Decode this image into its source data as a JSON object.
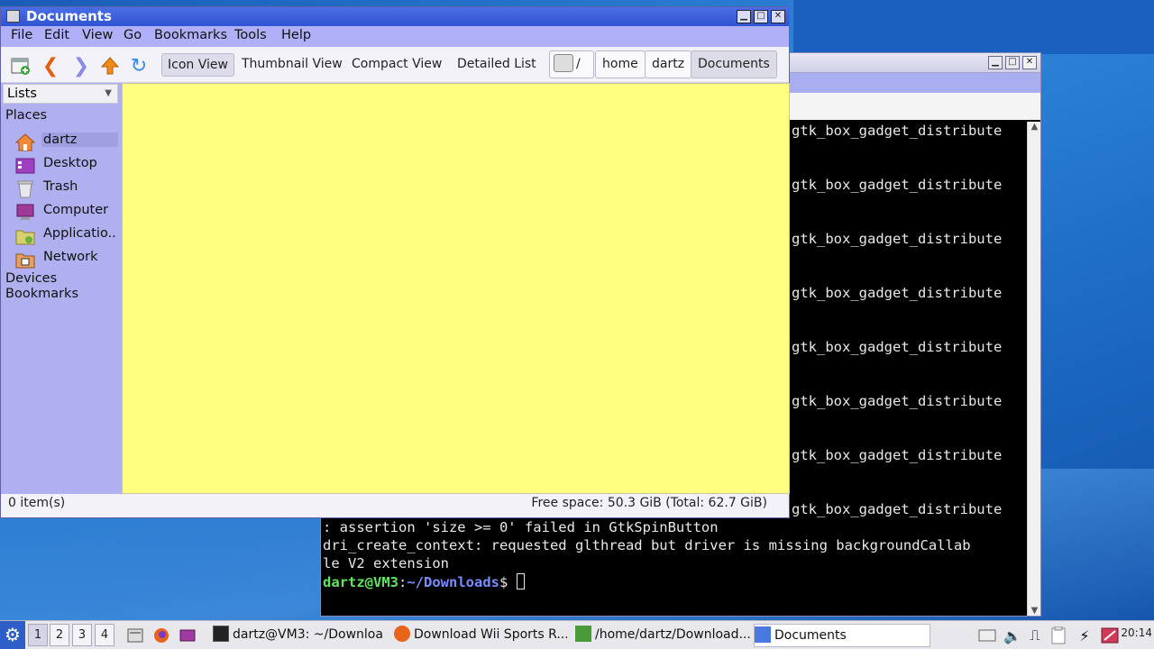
{
  "terminal": {
    "repeated_line": "gtk_box_gadget_distribute",
    "lines": [
      ": assertion 'size >= 0' failed in GtkSpinButton",
      "dri_create_context: requested glthread but driver is missing backgroundCallab",
      "le V2 extension"
    ],
    "prompt_user": "dartz@VM3",
    "prompt_sep": ":",
    "prompt_path": "~/Downloads",
    "prompt_end": "$ "
  },
  "file_manager": {
    "title": "Documents",
    "menu": [
      "File",
      "Edit",
      "View",
      "Go",
      "Bookmarks",
      "Tools",
      "Help"
    ],
    "view_modes": [
      "Icon View",
      "Thumbnail View",
      "Compact View",
      "Detailed List"
    ],
    "breadcrumbs": [
      "/",
      "home",
      "dartz",
      "Documents"
    ],
    "sidebar": {
      "combo": "Lists",
      "places_heading": "Places",
      "places": [
        "dartz",
        "Desktop",
        "Trash",
        "Computer",
        "Applicatio...",
        "Network"
      ],
      "devices_heading": "Devices",
      "bookmarks_heading": "Bookmarks"
    },
    "status_left": "0 item(s)",
    "status_right": "Free space: 50.3 GiB (Total: 62.7 GiB)",
    "main_bg": "#ffff80"
  },
  "taskbar": {
    "workspaces": [
      "1",
      "2",
      "3",
      "4"
    ],
    "tasks": [
      "dartz@VM3: ~/Downloa...",
      "Download Wii Sports R...",
      "/home/dartz/Download...",
      "Documents"
    ],
    "clock": "20:14"
  },
  "window_buttons": {
    "minimize": "▁",
    "maximize": "□",
    "close": "✕"
  }
}
